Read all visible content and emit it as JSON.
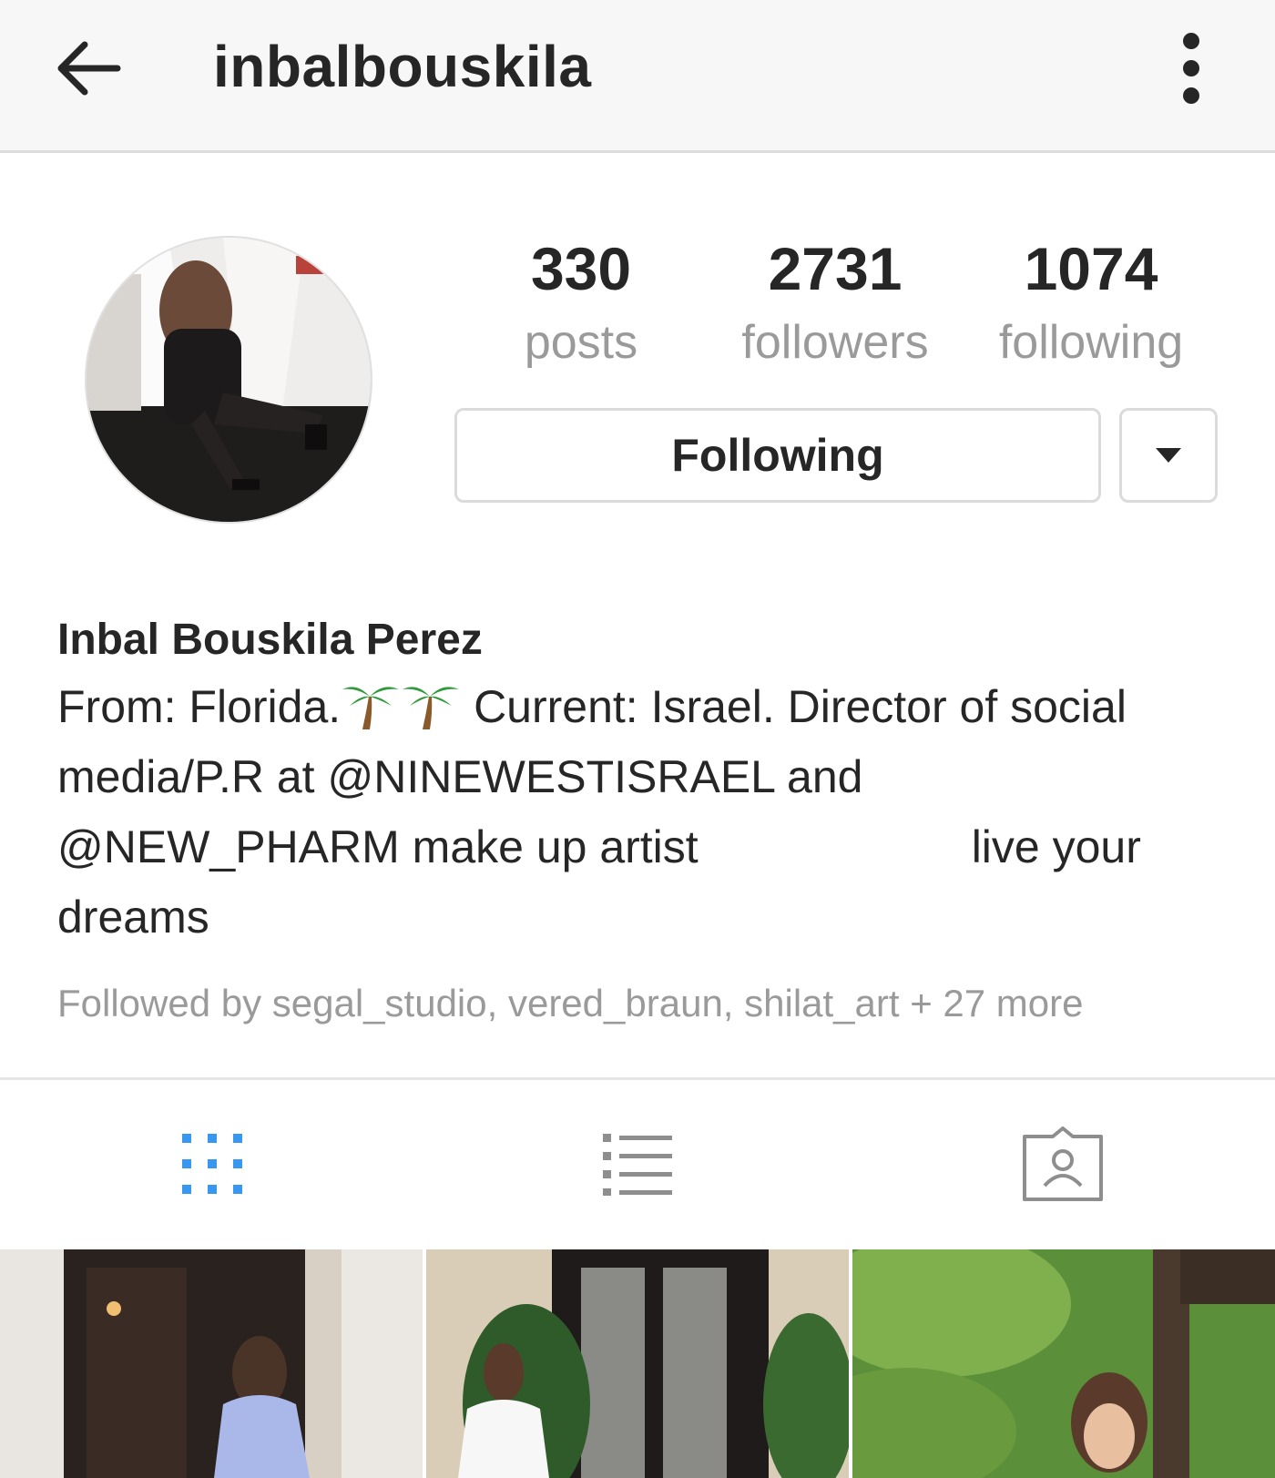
{
  "header": {
    "username": "inbalbouskila",
    "back_icon": "arrow-left-icon",
    "more_icon": "more-vertical-icon"
  },
  "profile": {
    "avatar_alt": "profile-photo",
    "stats": [
      {
        "value": "330",
        "label": "posts"
      },
      {
        "value": "2731",
        "label": "followers"
      },
      {
        "value": "1074",
        "label": "following"
      }
    ],
    "following_button": "Following",
    "dropdown_icon": "caret-down-icon"
  },
  "bio": {
    "full_name": "Inbal Bouskila Perez",
    "line1_prefix": "From: Florida.",
    "line1_suffix": " Current: Israel. Director of social",
    "line2_prefix": "media/P.R at ",
    "line2_mention": "@NINEWESTISRAEL",
    "line2_suffix": " and",
    "line3_mention": "@NEW_PHARM",
    "line3_mid": " make up artist",
    "line3_end": "live your",
    "line4": "dreams",
    "followed_by": "Followed by segal_studio, vered_braun, shilat_art + 27 more"
  },
  "tabs": [
    {
      "name": "grid-view-icon",
      "active": true
    },
    {
      "name": "list-view-icon",
      "active": false
    },
    {
      "name": "tagged-photos-icon",
      "active": false
    }
  ],
  "colors": {
    "accent": "#3897f0",
    "text": "#262626",
    "muted": "#9a9a9a",
    "border": "#dbdbdb"
  }
}
